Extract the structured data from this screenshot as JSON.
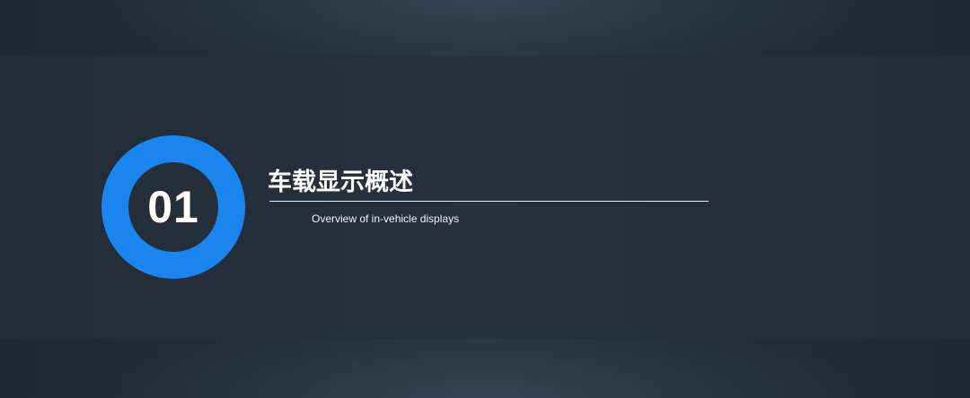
{
  "section": {
    "number": "01",
    "title": "车载显示概述",
    "subtitle": "Overview of in-vehicle displays"
  },
  "colors": {
    "accent": "#1a84ef",
    "background": "#222d38",
    "text": "#ffffff"
  }
}
